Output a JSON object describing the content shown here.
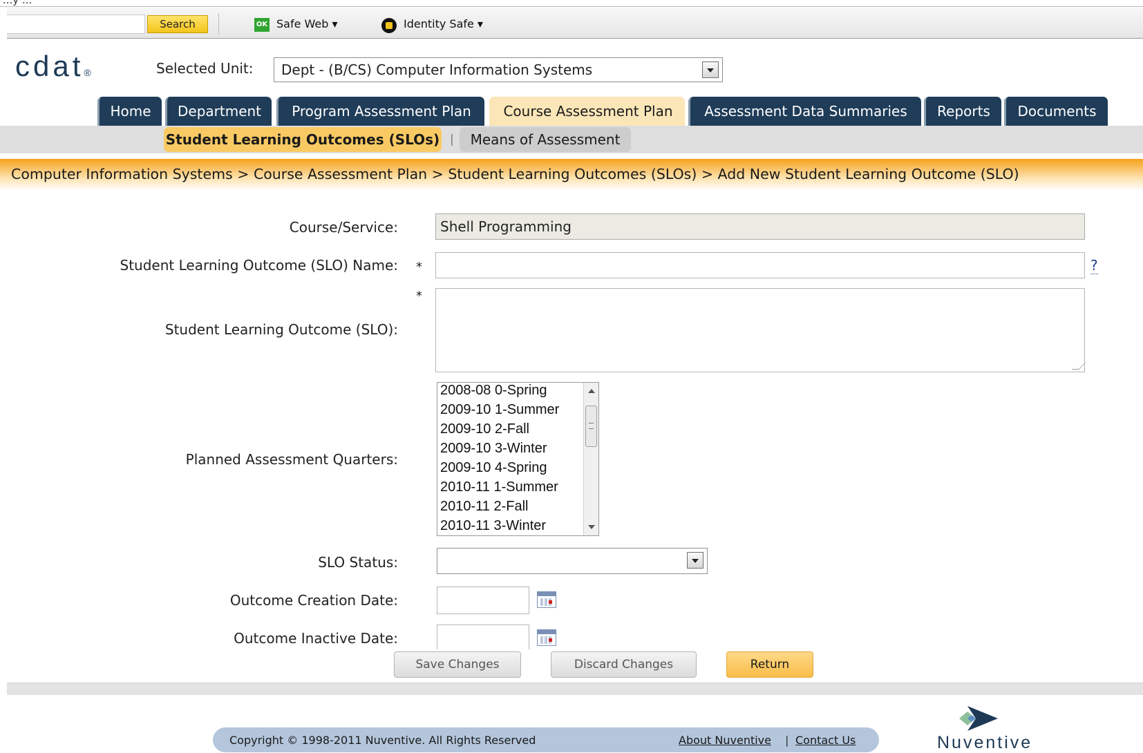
{
  "browser_toolbar": {
    "cut_text": "...y ...",
    "search_label": "Search",
    "ok_badge": "OK",
    "safe_web_label": "Safe Web ▾",
    "identity_safe_label": "Identity Safe ▾"
  },
  "header": {
    "logo_text": "cdat",
    "logo_mark": "®",
    "selected_unit_label": "Selected Unit:",
    "selected_unit_value": "Dept - (B/CS) Computer Information Systems"
  },
  "tabs": [
    {
      "label": "Home",
      "active": false
    },
    {
      "label": "Department",
      "active": false
    },
    {
      "label": "Program Assessment Plan",
      "active": false
    },
    {
      "label": "Course Assessment Plan",
      "active": true
    },
    {
      "label": "Assessment Data Summaries",
      "active": false
    },
    {
      "label": "Reports",
      "active": false
    },
    {
      "label": "Documents",
      "active": false
    }
  ],
  "subnav": {
    "active_label": "Student Learning Outcomes (SLOs)",
    "separator": "|",
    "other_label": "Means of Assessment"
  },
  "breadcrumb": "Computer Information Systems > Course Assessment Plan > Student Learning Outcomes (SLOs) > Add New Student Learning Outcome (SLO)",
  "form": {
    "course_label": "Course/Service:",
    "course_value": "Shell Programming",
    "slo_name_label": "Student Learning Outcome (SLO) Name:",
    "required_mark": "*",
    "help_link": "?",
    "slo_name_value": "",
    "slo_label": "Student Learning Outcome (SLO):",
    "slo_value": "",
    "quarters_label": "Planned Assessment Quarters:",
    "quarters_options": [
      "2008-08 0-Spring",
      "2009-10 1-Summer",
      "2009-10 2-Fall",
      "2009-10 3-Winter",
      "2009-10 4-Spring",
      "2010-11 1-Summer",
      "2010-11 2-Fall",
      "2010-11 3-Winter"
    ],
    "status_label": "SLO Status:",
    "status_value": "",
    "creation_date_label": "Outcome Creation Date:",
    "inactive_date_label": "Outcome Inactive Date:"
  },
  "buttons": {
    "save": "Save Changes",
    "discard": "Discard Changes",
    "return": "Return"
  },
  "footer": {
    "copyright": "Copyright © 1998-2011 Nuventive. All Rights Reserved",
    "about_link": "About Nuventive",
    "separator": "|",
    "contact_link": "Contact Us",
    "brand": "Nuventive"
  },
  "colors": {
    "tab_bg": "#1f3c58",
    "tab_active_bg": "#fbe6b8",
    "subnav_active_bg": "#f9ca63",
    "breadcrumb_orange": "#f6a01c",
    "footer_bar": "#b3c6dc"
  }
}
